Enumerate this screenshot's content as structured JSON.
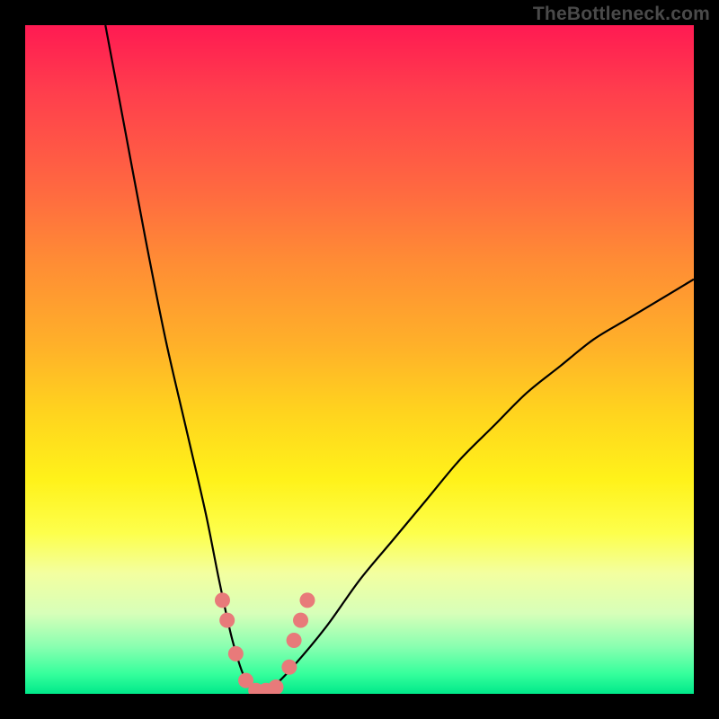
{
  "watermark": "TheBottleneck.com",
  "colors": {
    "frame": "#000000",
    "curve_stroke": "#000000",
    "marker_fill": "#e87a7a",
    "marker_stroke": "#c96060"
  },
  "chart_data": {
    "type": "line",
    "title": "",
    "xlabel": "",
    "ylabel": "",
    "xlim": [
      0,
      100
    ],
    "ylim": [
      0,
      100
    ],
    "grid": false,
    "legend": false,
    "annotations": [],
    "description": "Single V-shaped bottleneck curve over red-yellow-green gradient. Minimum near x≈35 at y≈0 (green zone). Left branch reaches y=100 near x≈12; right branch rises to y≈62 at x=100.",
    "series": [
      {
        "name": "bottleneck-curve",
        "x": [
          12,
          15,
          18,
          21,
          24,
          27,
          29,
          31,
          33,
          35,
          37,
          40,
          45,
          50,
          55,
          60,
          65,
          70,
          75,
          80,
          85,
          90,
          95,
          100
        ],
        "y": [
          100,
          84,
          68,
          53,
          40,
          27,
          17,
          8,
          2,
          0,
          1,
          4,
          10,
          17,
          23,
          29,
          35,
          40,
          45,
          49,
          53,
          56,
          59,
          62
        ]
      }
    ],
    "markers": {
      "name": "highlight-points",
      "x": [
        29.5,
        30.2,
        31.5,
        33,
        34.5,
        36,
        37.5,
        39.5,
        40.2,
        41.2,
        42.2
      ],
      "y": [
        14,
        11,
        6,
        2,
        0.5,
        0.5,
        1,
        4,
        8,
        11,
        14
      ]
    }
  }
}
